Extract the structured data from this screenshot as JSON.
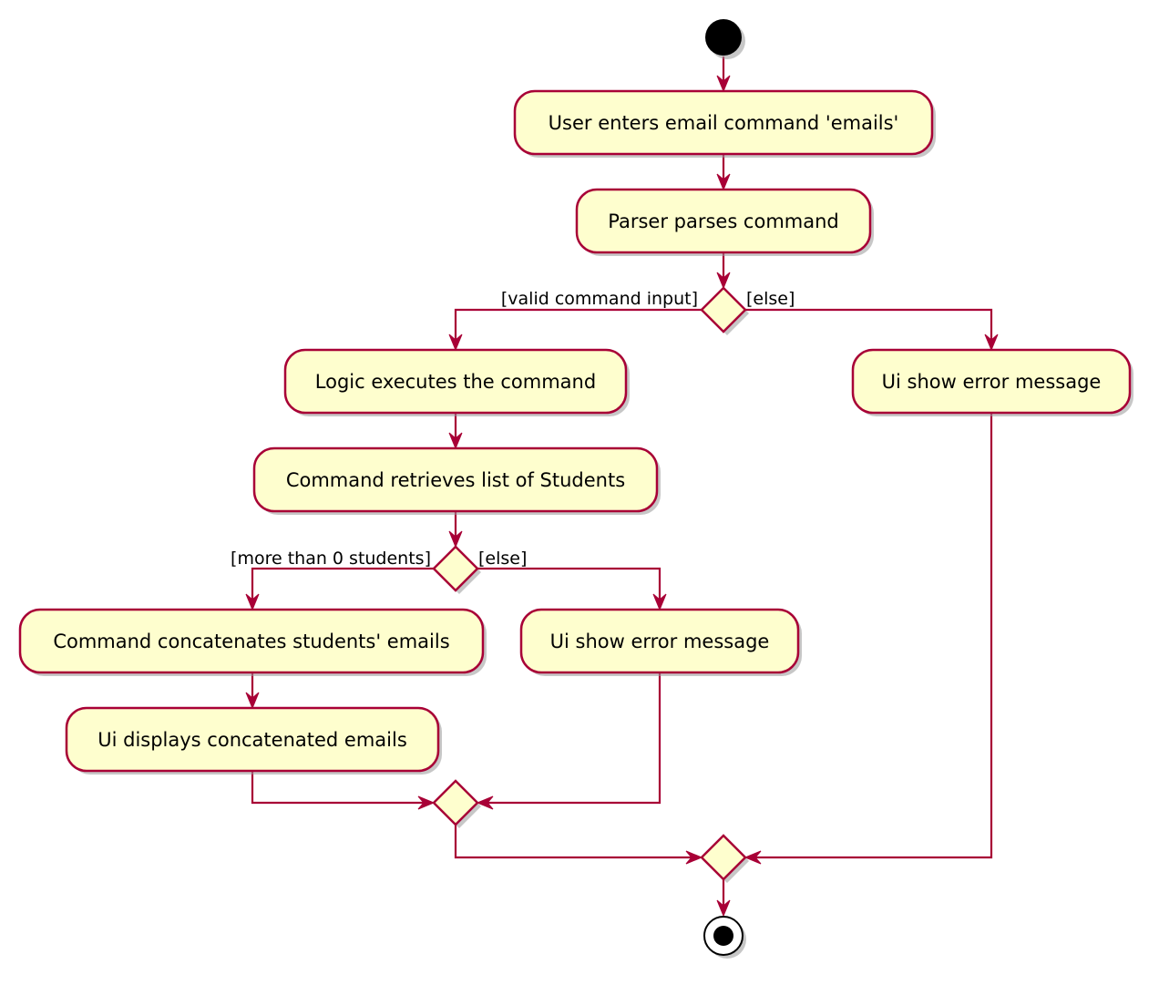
{
  "diagram": {
    "type": "activity",
    "colors": {
      "line": "#A80036",
      "fill": "#FEFECE",
      "text": "#000000",
      "start_end": "#000000"
    },
    "nodes": {
      "start": {
        "kind": "initial"
      },
      "user_enters": {
        "kind": "action",
        "label": "User enters email command 'emails'"
      },
      "parser_parses": {
        "kind": "action",
        "label": "Parser parses command"
      },
      "decision_valid": {
        "kind": "decision"
      },
      "logic_executes": {
        "kind": "action",
        "label": "Logic executes the command"
      },
      "ui_error_right": {
        "kind": "action",
        "label": "Ui show error message"
      },
      "command_retrieves": {
        "kind": "action",
        "label": "Command retrieves list of Students"
      },
      "decision_students": {
        "kind": "decision"
      },
      "command_concatenates": {
        "kind": "action",
        "label": "Command concatenates students' emails"
      },
      "ui_error_middle": {
        "kind": "action",
        "label": "Ui show error message"
      },
      "ui_displays": {
        "kind": "action",
        "label": "Ui displays concatenated emails"
      },
      "merge_inner": {
        "kind": "merge"
      },
      "merge_outer": {
        "kind": "merge"
      },
      "end": {
        "kind": "final"
      }
    },
    "guards": {
      "valid_input": "[valid command input]",
      "valid_else": "[else]",
      "more_students": "[more than 0 students]",
      "students_else": "[else]"
    },
    "edges": [
      {
        "from": "start",
        "to": "user_enters"
      },
      {
        "from": "user_enters",
        "to": "parser_parses"
      },
      {
        "from": "parser_parses",
        "to": "decision_valid"
      },
      {
        "from": "decision_valid",
        "to": "logic_executes",
        "guard": "[valid command input]"
      },
      {
        "from": "decision_valid",
        "to": "ui_error_right",
        "guard": "[else]"
      },
      {
        "from": "logic_executes",
        "to": "command_retrieves"
      },
      {
        "from": "command_retrieves",
        "to": "decision_students"
      },
      {
        "from": "decision_students",
        "to": "command_concatenates",
        "guard": "[more than 0 students]"
      },
      {
        "from": "decision_students",
        "to": "ui_error_middle",
        "guard": "[else]"
      },
      {
        "from": "command_concatenates",
        "to": "ui_displays"
      },
      {
        "from": "ui_displays",
        "to": "merge_inner"
      },
      {
        "from": "ui_error_middle",
        "to": "merge_inner"
      },
      {
        "from": "merge_inner",
        "to": "merge_outer"
      },
      {
        "from": "ui_error_right",
        "to": "merge_outer"
      },
      {
        "from": "merge_outer",
        "to": "end"
      }
    ]
  }
}
